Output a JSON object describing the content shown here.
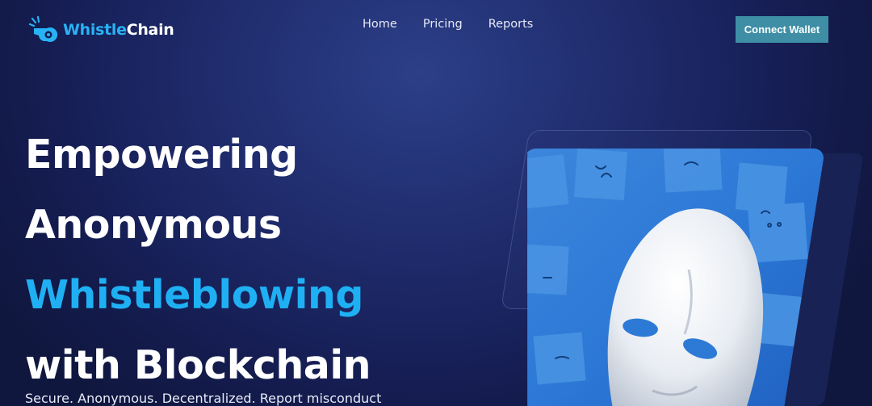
{
  "nav": {
    "brand_part1": "Whistle",
    "brand_part2": "Chain",
    "links": [
      "Home",
      "Pricing",
      "Reports"
    ],
    "connect_label": "Connect Wallet"
  },
  "hero": {
    "line1": "Empowering",
    "line2": "Anonymous",
    "line3": "Whistleblowing",
    "line4": "with Blockchain",
    "subtitle": "Secure. Anonymous. Decentralized. Report misconduct"
  },
  "colors": {
    "accent": "#1fb0f4",
    "button": "#3e8fa5",
    "background": "#1e2a6a"
  },
  "icons": {
    "logo": "whistle-icon"
  },
  "image": {
    "subject": "white-mask-on-blue-sticky-notes"
  }
}
